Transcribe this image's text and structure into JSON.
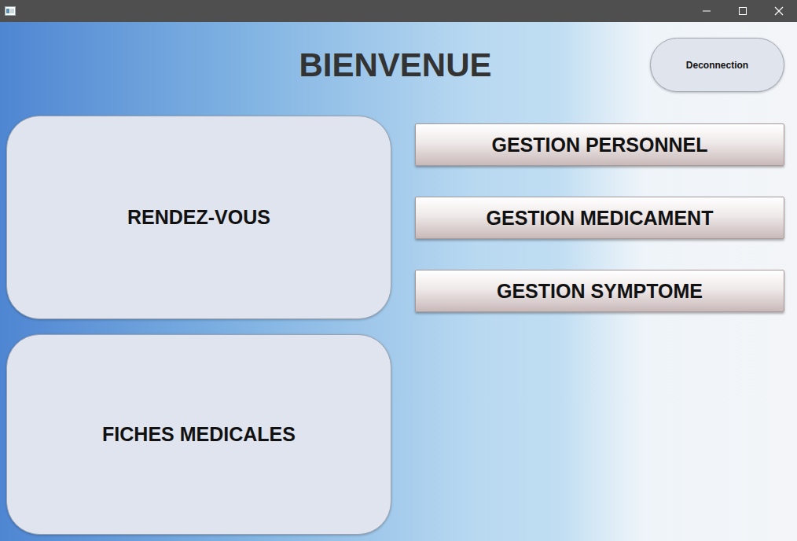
{
  "window": {
    "title": ""
  },
  "header": {
    "title": "BIENVENUE",
    "logout": "Deconnection"
  },
  "cards": [
    {
      "label": "RENDEZ-VOUS"
    },
    {
      "label": "FICHES MEDICALES"
    }
  ],
  "menu": [
    {
      "label": "GESTION PERSONNEL"
    },
    {
      "label": "GESTION MEDICAMENT"
    },
    {
      "label": "GESTION SYMPTOME"
    }
  ]
}
